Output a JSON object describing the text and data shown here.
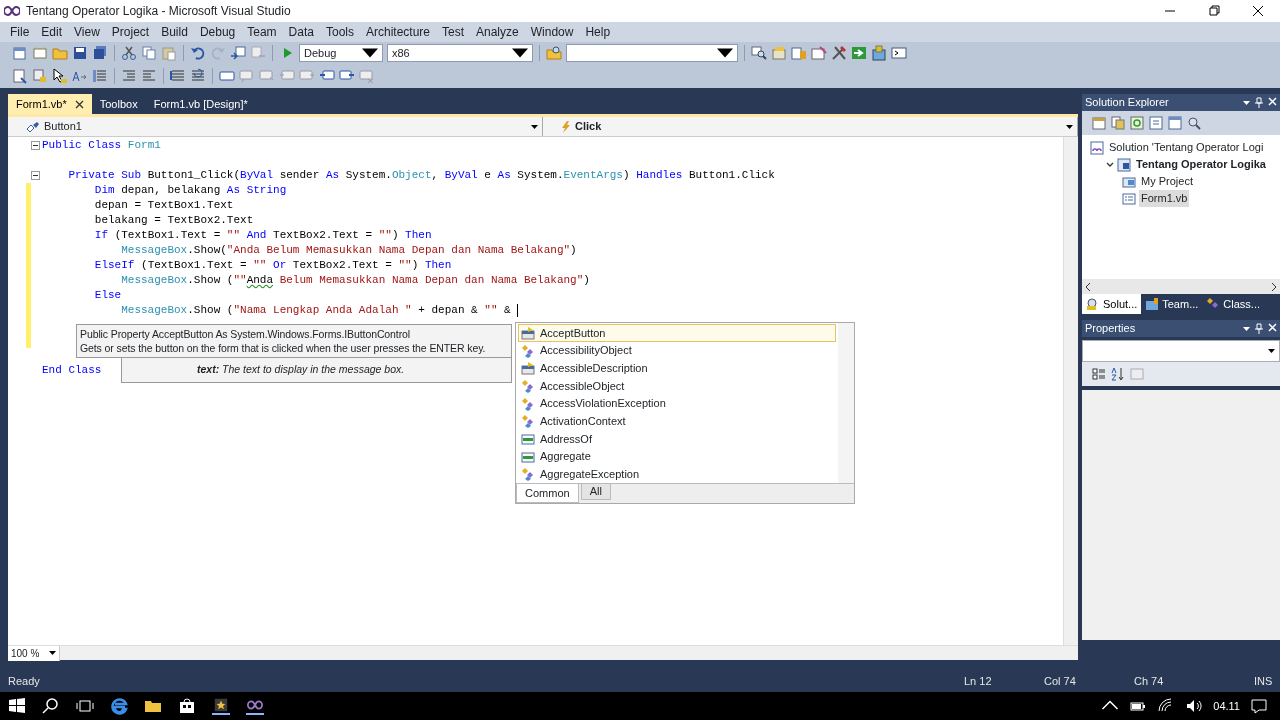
{
  "window": {
    "title": "Tentang Operator Logika - Microsoft Visual Studio"
  },
  "menu": [
    "File",
    "Edit",
    "View",
    "Project",
    "Build",
    "Debug",
    "Team",
    "Data",
    "Tools",
    "Architecture",
    "Test",
    "Analyze",
    "Window",
    "Help"
  ],
  "toolbar": {
    "configuration": "Debug",
    "platform": "x86"
  },
  "editor_tabs": [
    {
      "label": "Form1.vb*",
      "selected": true
    },
    {
      "label": "Toolbox",
      "selected": false
    },
    {
      "label": "Form1.vb [Design]*",
      "selected": false
    }
  ],
  "navigation": {
    "object": "Button1",
    "member": "Click"
  },
  "code_lines": [
    {
      "fold": true,
      "changed": false,
      "tokens": [
        {
          "kind": "keyword",
          "text": "Public Class "
        },
        {
          "kind": "type",
          "text": "Form1"
        }
      ]
    },
    {
      "fold": false,
      "changed": false
    },
    {
      "fold": true,
      "changed": false,
      "tokens": [
        {
          "kind": "keyword",
          "text": "    Private Sub "
        },
        {
          "kind": "plain",
          "text": "Button1_Click("
        },
        {
          "kind": "keyword",
          "text": "ByVal "
        },
        {
          "kind": "plain",
          "text": "sender "
        },
        {
          "kind": "keyword",
          "text": "As "
        },
        {
          "kind": "plain",
          "text": "System."
        },
        {
          "kind": "type",
          "text": "Object"
        },
        {
          "kind": "plain",
          "text": ", "
        },
        {
          "kind": "keyword",
          "text": "ByVal "
        },
        {
          "kind": "plain",
          "text": "e "
        },
        {
          "kind": "keyword",
          "text": "As "
        },
        {
          "kind": "plain",
          "text": "System."
        },
        {
          "kind": "type",
          "text": "EventArgs"
        },
        {
          "kind": "plain",
          "text": ") "
        },
        {
          "kind": "keyword",
          "text": "Handles "
        },
        {
          "kind": "plain",
          "text": "Button1.Click"
        }
      ]
    },
    {
      "fold": false,
      "changed": true,
      "tokens": [
        {
          "kind": "keyword",
          "text": "        Dim "
        },
        {
          "kind": "plain",
          "text": "depan, belakang "
        },
        {
          "kind": "keyword",
          "text": "As String"
        }
      ]
    },
    {
      "fold": false,
      "changed": true,
      "tokens": [
        {
          "kind": "plain",
          "text": "        depan = TextBox1.Text"
        }
      ]
    },
    {
      "fold": false,
      "changed": true,
      "tokens": [
        {
          "kind": "plain",
          "text": "        belakang = TextBox2.Text"
        }
      ]
    },
    {
      "fold": false,
      "changed": true,
      "tokens": [
        {
          "kind": "keyword",
          "text": "        If "
        },
        {
          "kind": "plain",
          "text": "(TextBox1.Text = "
        },
        {
          "kind": "string",
          "text": "\"\""
        },
        {
          "kind": "keyword",
          "text": " And "
        },
        {
          "kind": "plain",
          "text": "TextBox2.Text = "
        },
        {
          "kind": "string",
          "text": "\"\""
        },
        {
          "kind": "plain",
          "text": ") "
        },
        {
          "kind": "keyword",
          "text": "Then"
        }
      ]
    },
    {
      "fold": false,
      "changed": true,
      "tokens": [
        {
          "kind": "type",
          "text": "            MessageBox"
        },
        {
          "kind": "plain",
          "text": ".Show("
        },
        {
          "kind": "string",
          "text": "\"Anda Belum Memasukkan Nama Depan dan Nama Belakang\""
        },
        {
          "kind": "plain",
          "text": ")"
        }
      ]
    },
    {
      "fold": false,
      "changed": true,
      "tokens": [
        {
          "kind": "keyword",
          "text": "        ElseIf "
        },
        {
          "kind": "plain",
          "text": "(TextBox1.Text = "
        },
        {
          "kind": "string",
          "text": "\"\""
        },
        {
          "kind": "keyword",
          "text": " Or "
        },
        {
          "kind": "plain",
          "text": "TextBox2.Text = "
        },
        {
          "kind": "string",
          "text": "\"\""
        },
        {
          "kind": "plain",
          "text": ") "
        },
        {
          "kind": "keyword",
          "text": "Then"
        }
      ]
    },
    {
      "fold": false,
      "changed": true,
      "tokens": [
        {
          "kind": "type",
          "text": "            MessageBox"
        },
        {
          "kind": "plain",
          "text": ".Show ("
        },
        {
          "kind": "string",
          "text": "\"\""
        },
        {
          "kind": "error",
          "text": "Anda"
        },
        {
          "kind": "string",
          "text": " Belum Memasukkan Nama Depan dan Nama Belakang\""
        },
        {
          "kind": "plain",
          "text": ")"
        }
      ]
    },
    {
      "fold": false,
      "changed": true,
      "tokens": [
        {
          "kind": "keyword",
          "text": "        Else"
        }
      ]
    },
    {
      "fold": false,
      "changed": true,
      "caret": true,
      "tokens": [
        {
          "kind": "type",
          "text": "            MessageBox"
        },
        {
          "kind": "plain",
          "text": ".Show ("
        },
        {
          "kind": "string",
          "text": "\"Nama Lengkap Anda Adalah \""
        },
        {
          "kind": "plain",
          "text": " + depan & "
        },
        {
          "kind": "string",
          "text": "\"\""
        },
        {
          "kind": "plain",
          "text": " &"
        }
      ]
    },
    {
      "fold": false,
      "changed": true
    },
    {
      "fold": false,
      "changed": true
    },
    {
      "fold": false,
      "changed": false
    },
    {
      "fold": false,
      "changed": false,
      "tokens": [
        {
          "kind": "keyword",
          "text": "End Class"
        }
      ]
    }
  ],
  "quick_info": {
    "signature": "Public Property AcceptButton As System.Windows.Forms.IButtonControl",
    "description": "Gets or sets the button on the form that is clicked when the user presses the ENTER key.",
    "parameter_name": "text:",
    "parameter_description": "The text to display in the message box."
  },
  "completion_list": {
    "items": [
      {
        "label": "AcceptButton",
        "kind": "property",
        "selected": true
      },
      {
        "label": "AccessibilityObject",
        "kind": "class",
        "selected": false
      },
      {
        "label": "AccessibleDescription",
        "kind": "property",
        "selected": false
      },
      {
        "label": "AccessibleObject",
        "kind": "class",
        "selected": false
      },
      {
        "label": "AccessViolationException",
        "kind": "class",
        "selected": false
      },
      {
        "label": "ActivationContext",
        "kind": "class",
        "selected": false
      },
      {
        "label": "AddressOf",
        "kind": "keyword",
        "selected": false
      },
      {
        "label": "Aggregate",
        "kind": "keyword",
        "selected": false
      },
      {
        "label": "AggregateException",
        "kind": "class",
        "selected": false
      }
    ],
    "tabs": [
      {
        "label": "Common",
        "selected": true
      },
      {
        "label": "All",
        "selected": false
      }
    ]
  },
  "zoom": "100 %",
  "solution_explorer": {
    "title": "Solution Explorer",
    "tree": [
      {
        "label": "Solution 'Tentang Operator Logi",
        "kind": "solution",
        "selected": false,
        "children": [
          {
            "label": "Tentang Operator Logika",
            "kind": "project",
            "expanded": true,
            "selected": false,
            "children": [
              {
                "label": "My Project",
                "kind": "settings",
                "selected": false
              },
              {
                "label": "Form1.vb",
                "kind": "form",
                "selected": true
              }
            ]
          }
        ]
      }
    ],
    "tabs": [
      {
        "label": "Solut...",
        "selected": true
      },
      {
        "label": "Team...",
        "selected": false
      },
      {
        "label": "Class...",
        "selected": false
      }
    ]
  },
  "properties": {
    "title": "Properties"
  },
  "status_bar": {
    "message": "Ready",
    "line": "Ln 12",
    "column": "Col 74",
    "character": "Ch 74",
    "mode": "INS"
  },
  "taskbar": {
    "time": "04.11"
  }
}
